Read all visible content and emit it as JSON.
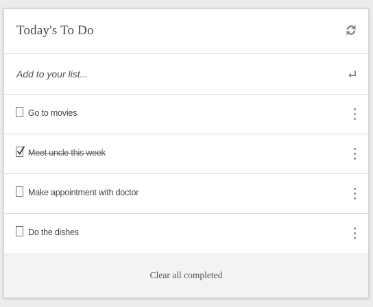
{
  "header": {
    "title": "Today's To Do",
    "refresh_icon": "refresh-icon"
  },
  "add": {
    "placeholder": "Add to your list...",
    "enter_icon": "enter-icon"
  },
  "items": [
    {
      "label": "Go to movies",
      "completed": false
    },
    {
      "label": "Meet uncle this week",
      "completed": true
    },
    {
      "label": "Make appointment with doctor",
      "completed": false
    },
    {
      "label": "Do the dishes",
      "completed": false
    }
  ],
  "footer": {
    "clear_label": "Clear all completed"
  },
  "colors": {
    "background": "#ececec",
    "card": "#ffffff",
    "footer": "#f3f3f3",
    "divider": "#dcdcdc",
    "text": "#444444",
    "icon": "#8a8a8a"
  }
}
